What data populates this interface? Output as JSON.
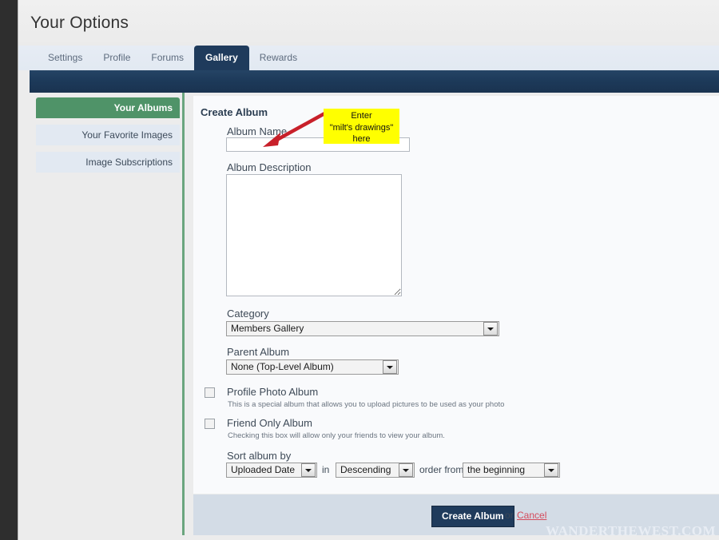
{
  "header": {
    "title": "Your Options"
  },
  "tabs": [
    {
      "label": "Settings",
      "active": false
    },
    {
      "label": "Profile",
      "active": false
    },
    {
      "label": "Forums",
      "active": false
    },
    {
      "label": "Gallery",
      "active": true
    },
    {
      "label": "Rewards",
      "active": false
    }
  ],
  "sidebar": {
    "items": [
      {
        "label": "Your Albums",
        "active": true
      },
      {
        "label": "Your Favorite Images",
        "active": false
      },
      {
        "label": "Image Subscriptions",
        "active": false
      }
    ]
  },
  "form": {
    "heading": "Create Album",
    "album_name": {
      "label": "Album Name",
      "value": "",
      "placeholder": ""
    },
    "album_description": {
      "label": "Album Description",
      "value": "",
      "placeholder": ""
    },
    "category": {
      "label": "Category",
      "value": "Members Gallery"
    },
    "parent_album": {
      "label": "Parent Album",
      "value": "None (Top-Level Album)"
    },
    "profile_photo_album": {
      "label": "Profile Photo Album",
      "note": "This is a special album that allows you to upload pictures to be used as your photo",
      "checked": false
    },
    "friend_only_album": {
      "label": "Friend Only Album",
      "note": "Checking this box will allow only your friends to view your album.",
      "checked": false
    },
    "sort": {
      "label": "Sort album by",
      "field_value": "Uploaded Date",
      "joiner_in": "in",
      "direction_value": "Descending",
      "joiner_order_from": "order from",
      "origin_value": "the beginning"
    }
  },
  "footer": {
    "submit_label": "Create Album",
    "or_label": "or",
    "cancel_label": "Cancel"
  },
  "annotation": {
    "line1": "Enter",
    "line2": "\"milt's drawings\"",
    "line3": "here",
    "box_color": "#ffff00",
    "arrow_color": "#c8202a"
  },
  "watermark": {
    "text": "WANDERTHEWEST.COM"
  },
  "colors": {
    "navy": "#1f3b5c",
    "green": "#4f9368",
    "footer": "#d3dce6",
    "tabstrip": "#e4ebf3"
  }
}
